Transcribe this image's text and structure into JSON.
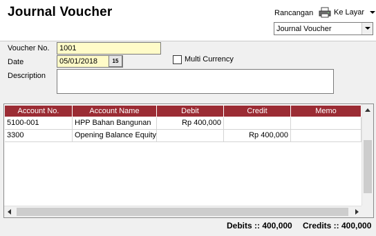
{
  "header": {
    "title": "Journal Voucher",
    "design_label": "Rancangan",
    "output_label": "Ke Layar",
    "template_value": "Journal Voucher"
  },
  "form": {
    "voucher_label": "Voucher No.",
    "voucher_value": "1001",
    "date_label": "Date",
    "date_value": "05/01/2018",
    "calendar_label": "15",
    "multi_currency_label": "Multi Currency",
    "multi_currency_checked": false,
    "description_label": "Description",
    "description_value": ""
  },
  "grid": {
    "columns": [
      "Account No.",
      "Account Name",
      "Debit",
      "Credit",
      "Memo"
    ],
    "rows": [
      [
        "5100-001",
        "HPP Bahan Bangunan",
        "Rp 400,000",
        "",
        ""
      ],
      [
        "3300",
        "Opening Balance Equity",
        "",
        "Rp 400,000",
        ""
      ]
    ]
  },
  "totals": {
    "debits": "Debits :: 400,000",
    "credits": "Credits :: 400,000"
  },
  "colors": {
    "header_red": "#9b2c34",
    "input_yellow": "#fffbc8"
  }
}
